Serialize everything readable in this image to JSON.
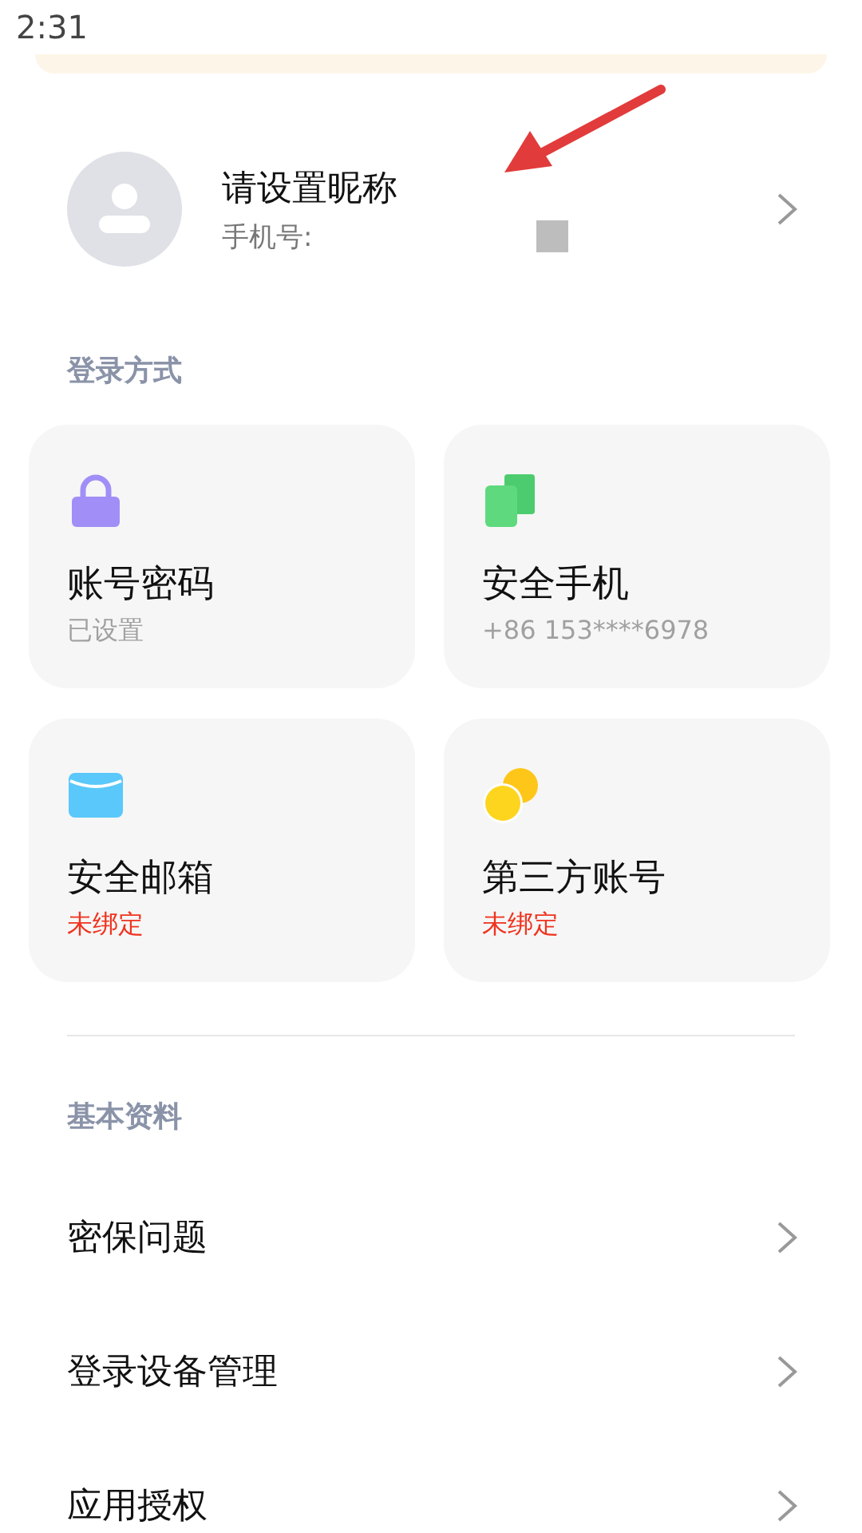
{
  "status_bar": {
    "time": "2:31"
  },
  "profile": {
    "nickname": "请设置昵称",
    "phone_label": "手机号:"
  },
  "login_section": {
    "title": "登录方式",
    "cards": [
      {
        "kind": "lock",
        "title": "账号密码",
        "status": "已设置",
        "bound": true
      },
      {
        "kind": "phone",
        "title": "安全手机",
        "status": "+86 153****6978",
        "bound": true
      },
      {
        "kind": "mail",
        "title": "安全邮箱",
        "status": "未绑定",
        "bound": false
      },
      {
        "kind": "coins",
        "title": "第三方账号",
        "status": "未绑定",
        "bound": false
      }
    ]
  },
  "basic_section": {
    "title": "基本资料",
    "items": [
      "密保问题",
      "登录设备管理",
      "应用授权"
    ]
  }
}
